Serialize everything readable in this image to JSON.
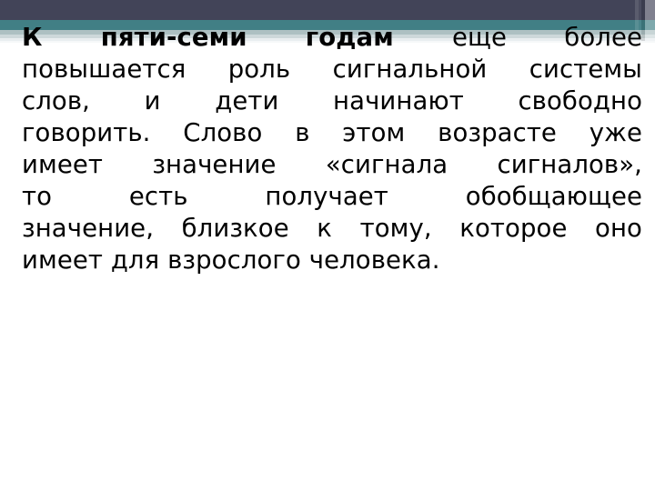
{
  "slide": {
    "background_color": "#ffffff",
    "banner": {
      "navy_color": "#424458",
      "teal_color": "#417f85",
      "mist_color": "#adc0c2"
    },
    "body": {
      "lead_text": "К пяти-семи годам",
      "full_text": "К пяти-семи годам еще более повышается роль сигнальной системы слов, и дети начинают свободно говорить. Слово в этом возрасте уже имеет значение «сигнала сигналов», то есть получает обобщающее значение, близкое к тому, которое оно имеет для взрослого человека.",
      "lines": [
        {
          "bold": "К пяти-семи годам",
          "rest": "еще более"
        },
        {
          "bold": "",
          "rest": "повышается роль сигнальной системы"
        },
        {
          "bold": "",
          "rest": "слов, и дети начинают свободно"
        },
        {
          "bold": "",
          "rest": "говорить. Слово в этом возрасте уже"
        },
        {
          "bold": "",
          "rest": "имеет значение «сигнала сигналов»,"
        },
        {
          "bold": "",
          "rest": "то есть получает обобщающее"
        },
        {
          "bold": "",
          "rest": "значение, близкое к тому, которое оно"
        },
        {
          "bold": "",
          "rest": "имеет для взрослого человека."
        }
      ],
      "line_1_bold": "К пяти-семи годам",
      "line_1_rest": "еще более",
      "line_2": "повышается роль сигнальной системы",
      "line_3": "слов, и дети начинают свободно",
      "line_4": "говорить. Слово в этом возрасте уже",
      "line_5": "имеет значение «сигнала сигналов»,",
      "line_6": "то есть получает обобщающее",
      "line_7": "значение, близкое к тому, которое оно",
      "line_8": "имеет для взрослого человека."
    }
  }
}
